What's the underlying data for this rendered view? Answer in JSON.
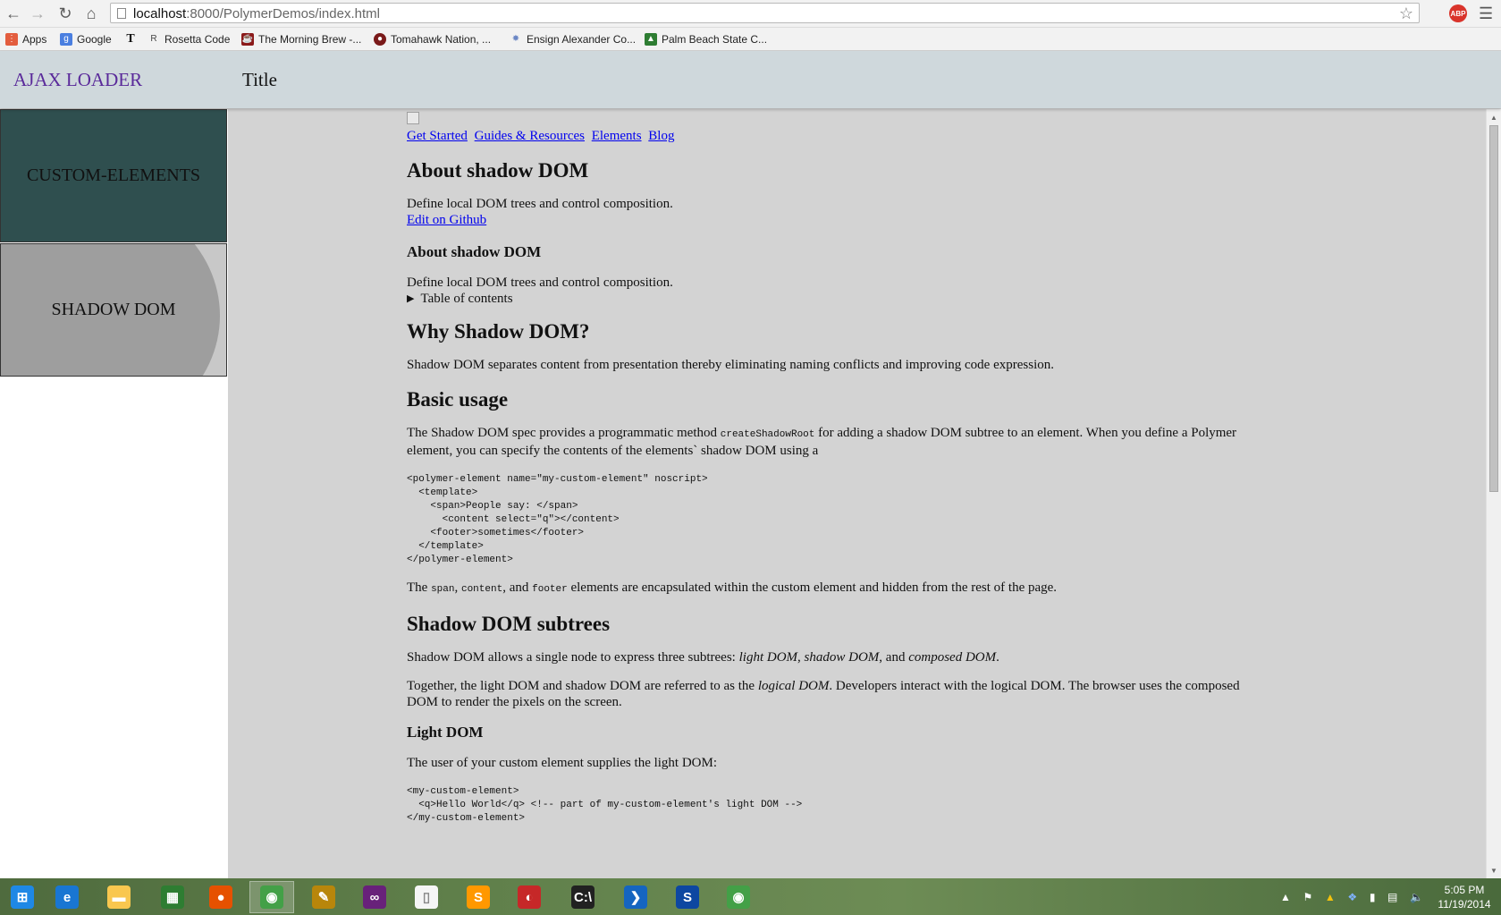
{
  "browser": {
    "url_host": "localhost",
    "url_rest": ":8000/PolymerDemos/index.html",
    "abp_label": "ABP",
    "bookmarks": [
      {
        "label": "Apps",
        "icon": "apps-grid-icon",
        "color": "#e35d3e"
      },
      {
        "label": "Google",
        "icon": "google-icon",
        "color": "#4a7fe0"
      },
      {
        "label": "",
        "icon": "nyt-icon",
        "color": "#111111"
      },
      {
        "label": "Rosetta Code",
        "icon": "rosetta-code-icon",
        "color": "#444444"
      },
      {
        "label": "The Morning Brew -...",
        "icon": "coffee-icon",
        "color": "#8b1a1a"
      },
      {
        "label": "Tomahawk Nation, ...",
        "icon": "tomahawk-nation-icon",
        "color": "#7a1a1a"
      },
      {
        "label": "Ensign Alexander Co...",
        "icon": "ensign-icon",
        "color": "#6a86c4"
      },
      {
        "label": "Palm Beach State C...",
        "icon": "palm-beach-icon",
        "color": "#2e7d32"
      }
    ]
  },
  "header": {
    "app_name": "AJAX LOADER",
    "title": "Title"
  },
  "sidebar": {
    "items": [
      {
        "label": "CUSTOM-ELEMENTS"
      },
      {
        "label": "SHADOW DOM"
      }
    ]
  },
  "content": {
    "nav_links": [
      "Get Started",
      "Guides & Resources",
      "Elements",
      "Blog"
    ],
    "h1_about": "About shadow DOM",
    "about_desc": "Define local DOM trees and control composition.",
    "edit_link": "Edit on Github",
    "h2_about": "About shadow DOM",
    "about_desc2": "Define local DOM trees and control composition.",
    "toc": "Table of contents",
    "h1_why": "Why Shadow DOM?",
    "why_text": "Shadow DOM separates content from presentation thereby eliminating naming conflicts and improving code expression.",
    "h1_basic": "Basic usage",
    "basic_text_1": "The Shadow DOM spec provides a programmatic method",
    "basic_code": "createShadowRoot",
    "basic_text_2": "for adding a shadow DOM subtree to an element. When you define a Polymer element, you can specify the contents of the elements` shadow DOM using a",
    "code_block_1": "<polymer-element name=\"my-custom-element\" noscript>\n  <template>\n    <span>People say: </span>\n      <content select=\"q\"></content>\n    <footer>sometimes</footer>\n  </template>\n</polymer-element>",
    "enc_the": "The",
    "enc_span": "span",
    "enc_content": "content",
    "enc_and": ", and",
    "enc_footer": "footer",
    "enc_rest": "elements are encapsulated within the custom element and hidden from the rest of the page.",
    "h1_subtrees": "Shadow DOM subtrees",
    "subtrees_text_1": "Shadow DOM allows a single node to express three subtrees:",
    "subtrees_light": "light DOM",
    "subtrees_shadow": "shadow DOM",
    "subtrees_and": ", and",
    "subtrees_composed": "composed DOM",
    "together_1": "Together, the light DOM and shadow DOM are referred to as the",
    "together_logical": "logical DOM",
    "together_2": ". Developers interact with the logical DOM. The browser uses the composed DOM to render the pixels on the screen.",
    "h2_light": "Light DOM",
    "light_text": "The user of your custom element supplies the light DOM:",
    "code_block_2": "<my-custom-element>\n  <q>Hello World</q> <!-- part of my-custom-element's light DOM -->\n</my-custom-element>"
  },
  "taskbar": {
    "apps": [
      {
        "name": "start-icon",
        "color": "#1e88e5",
        "glyph": "⊞"
      },
      {
        "name": "internet-explorer-icon",
        "color": "#1976d2",
        "glyph": "e"
      },
      {
        "name": "file-explorer-icon",
        "color": "#f9c74f",
        "glyph": "▬"
      },
      {
        "name": "windows-store-icon",
        "color": "#2e7d32",
        "glyph": "▦"
      },
      {
        "name": "firefox-icon",
        "color": "#e65100",
        "glyph": "●"
      },
      {
        "name": "chrome-icon",
        "color": "#43a047",
        "glyph": "◉"
      },
      {
        "name": "tools-icon",
        "color": "#b8860b",
        "glyph": "✎"
      },
      {
        "name": "visual-studio-icon",
        "color": "#68217a",
        "glyph": "∞"
      },
      {
        "name": "notepad-icon",
        "color": "#f5f5f5",
        "glyph": "▯"
      },
      {
        "name": "sublime-text-icon",
        "color": "#ff9800",
        "glyph": "S"
      },
      {
        "name": "pokeball-icon",
        "color": "#c62828",
        "glyph": "◐"
      },
      {
        "name": "command-prompt-icon",
        "color": "#212121",
        "glyph": "C:\\"
      },
      {
        "name": "powershell-icon",
        "color": "#1565c0",
        "glyph": "❯"
      },
      {
        "name": "skype-icon",
        "color": "#0d47a1",
        "glyph": "S"
      },
      {
        "name": "chrome-icon-2",
        "color": "#43a047",
        "glyph": "◉"
      }
    ],
    "clock_time": "5:05 PM",
    "clock_date": "11/19/2014"
  }
}
